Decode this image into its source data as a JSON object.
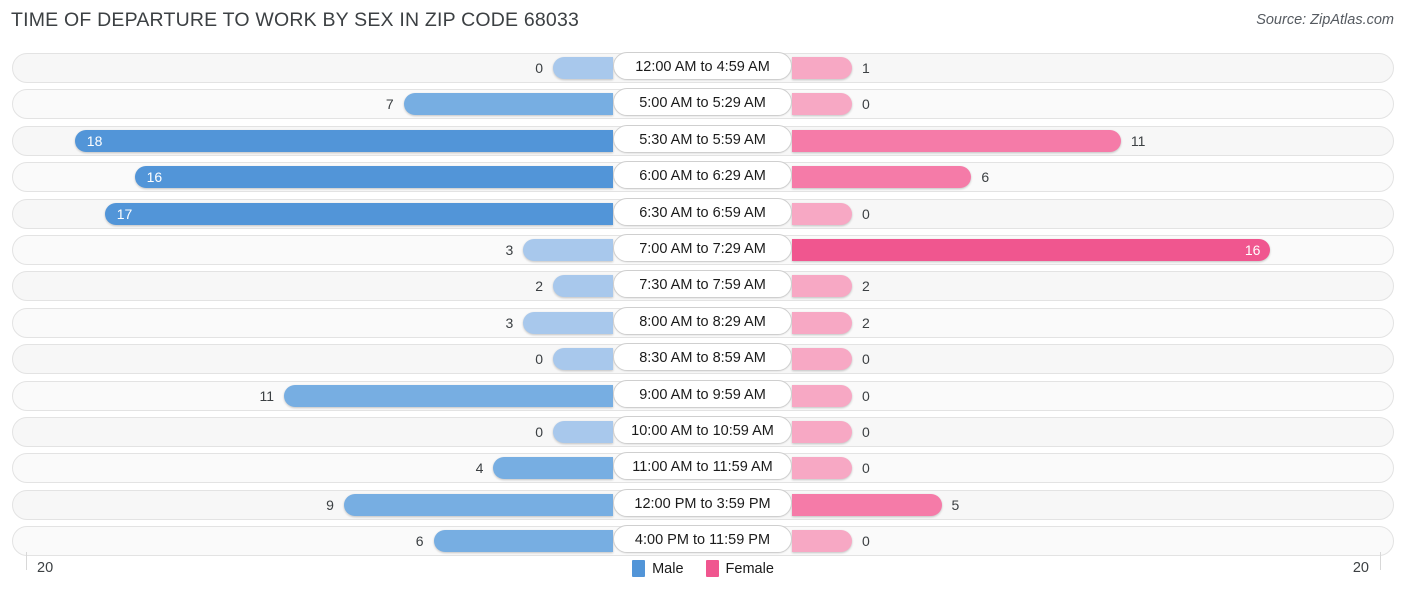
{
  "header": {
    "title": "TIME OF DEPARTURE TO WORK BY SEX IN ZIP CODE 68033",
    "source": "Source: ZipAtlas.com"
  },
  "legend": {
    "male_label": "Male",
    "female_label": "Female",
    "male_color": "#5295d8",
    "female_color": "#f0568f"
  },
  "axis": {
    "left_max": "20",
    "right_max": "20"
  },
  "chart_data": {
    "type": "bar",
    "title": "TIME OF DEPARTURE TO WORK BY SEX IN ZIP CODE 68033",
    "subtitle": "Source: ZipAtlas.com",
    "orientation": "horizontal-diverging",
    "xlabel": "",
    "ylabel": "",
    "xlim": [
      -20,
      20
    ],
    "axis_left_label": "20",
    "axis_right_label": "20",
    "grid": false,
    "legend_position": "bottom-center",
    "categories": [
      "12:00 AM to 4:59 AM",
      "5:00 AM to 5:29 AM",
      "5:30 AM to 5:59 AM",
      "6:00 AM to 6:29 AM",
      "6:30 AM to 6:59 AM",
      "7:00 AM to 7:29 AM",
      "7:30 AM to 7:59 AM",
      "8:00 AM to 8:29 AM",
      "8:30 AM to 8:59 AM",
      "9:00 AM to 9:59 AM",
      "10:00 AM to 10:59 AM",
      "11:00 AM to 11:59 AM",
      "12:00 PM to 3:59 PM",
      "4:00 PM to 11:59 PM"
    ],
    "series": [
      {
        "name": "Male",
        "values": [
          0,
          7,
          18,
          16,
          17,
          3,
          2,
          3,
          0,
          11,
          0,
          4,
          9,
          6
        ]
      },
      {
        "name": "Female",
        "values": [
          1,
          0,
          11,
          6,
          0,
          16,
          2,
          2,
          0,
          0,
          0,
          0,
          5,
          0
        ]
      }
    ]
  },
  "rows": [
    {
      "label": "12:00 AM to 4:59 AM",
      "male": "0",
      "female": "1"
    },
    {
      "label": "5:00 AM to 5:29 AM",
      "male": "7",
      "female": "0"
    },
    {
      "label": "5:30 AM to 5:59 AM",
      "male": "18",
      "female": "11"
    },
    {
      "label": "6:00 AM to 6:29 AM",
      "male": "16",
      "female": "6"
    },
    {
      "label": "6:30 AM to 6:59 AM",
      "male": "17",
      "female": "0"
    },
    {
      "label": "7:00 AM to 7:29 AM",
      "male": "3",
      "female": "16"
    },
    {
      "label": "7:30 AM to 7:59 AM",
      "male": "2",
      "female": "2"
    },
    {
      "label": "8:00 AM to 8:29 AM",
      "male": "3",
      "female": "2"
    },
    {
      "label": "8:30 AM to 8:59 AM",
      "male": "0",
      "female": "0"
    },
    {
      "label": "9:00 AM to 9:59 AM",
      "male": "11",
      "female": "0"
    },
    {
      "label": "10:00 AM to 10:59 AM",
      "male": "0",
      "female": "0"
    },
    {
      "label": "11:00 AM to 11:59 AM",
      "male": "4",
      "female": "0"
    },
    {
      "label": "12:00 PM to 3:59 PM",
      "male": "9",
      "female": "5"
    },
    {
      "label": "4:00 PM to 11:59 PM",
      "male": "6",
      "female": "0"
    }
  ]
}
